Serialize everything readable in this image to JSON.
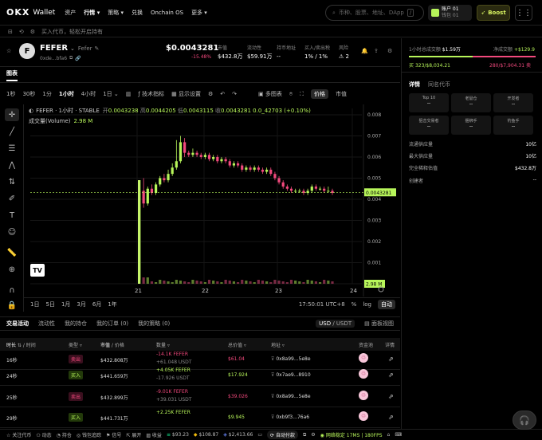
{
  "topnav": {
    "logo": "OKX",
    "product": "Wallet",
    "items": [
      "资产",
      "行情",
      "策略",
      "兑换",
      "Onchain OS",
      "更多"
    ],
    "active_index": 1,
    "search_placeholder": "币种、股票、地址、DApp",
    "search_shortcut": "/",
    "account_name": "账户 01",
    "account_sub": "钱包 01",
    "boost_label": "Boost"
  },
  "subbar": {
    "hint": "买入代币，轻松开启持有"
  },
  "token": {
    "avatar_letter": "F",
    "symbol": "FEFER",
    "name": "Fefer",
    "address": "0xde...bfa6",
    "price": "$0.0043281",
    "change": "-15.48%",
    "stats": [
      {
        "label": "市值",
        "value": "$432.8万"
      },
      {
        "label": "流动性",
        "value": "$59.91万"
      },
      {
        "label": "持币地址",
        "value": "--"
      },
      {
        "label": "买入/卖出税",
        "value": "1% / 1%"
      },
      {
        "label": "风险",
        "value": "2"
      }
    ]
  },
  "chart_tabs": {
    "tab": "图表"
  },
  "timeframes": {
    "items": [
      "1秒",
      "30秒",
      "1分",
      "1小时",
      "4小时",
      "1日"
    ],
    "active_index": 3,
    "indicators": "技术指标",
    "display": "显示设置",
    "multi": "多图表",
    "price_btn": "价格",
    "mcap_btn": "市值"
  },
  "legend": {
    "title": "FEFER · 1小时 · STABLE",
    "open_label": "开",
    "open": "0.0043238",
    "high_label": "高",
    "high": "0.0044205",
    "low_label": "低",
    "low": "0.0043115",
    "close_label": "收",
    "close": "0.0043281",
    "change": "0.0_42703 (+0.10%)",
    "volume_label": "成交量(Volume)",
    "volume": "2.98 M"
  },
  "chart_data": {
    "type": "candlestick",
    "xlabels": [
      "21",
      "22",
      "23",
      "24"
    ],
    "yticks": [
      "0.008",
      "0.007",
      "0.006",
      "0.005",
      "0.004",
      "0.003",
      "0.002",
      "0.001",
      "0.00"
    ],
    "ylim": [
      0,
      0.0083
    ],
    "last_price_label": "0.0043281",
    "last_volume_label": "2.98 M",
    "candles": [
      [
        0.0002,
        0.0044,
        0.0046,
        0.0001
      ],
      [
        0.0044,
        0.0038,
        0.005,
        0.0036
      ],
      [
        0.0038,
        0.0045,
        0.0046,
        0.0037
      ],
      [
        0.0045,
        0.0043,
        0.0047,
        0.0042
      ],
      [
        0.0043,
        0.0047,
        0.0048,
        0.0042
      ],
      [
        0.0047,
        0.005,
        0.0051,
        0.0046
      ],
      [
        0.005,
        0.0049,
        0.0052,
        0.0048
      ],
      [
        0.0049,
        0.0052,
        0.0054,
        0.0048
      ],
      [
        0.0052,
        0.0055,
        0.0057,
        0.0051
      ],
      [
        0.0055,
        0.0058,
        0.0068,
        0.0054
      ],
      [
        0.0058,
        0.0067,
        0.007,
        0.0057
      ],
      [
        0.0067,
        0.0062,
        0.0069,
        0.006
      ],
      [
        0.0062,
        0.0061,
        0.0063,
        0.006
      ],
      [
        0.0061,
        0.0062,
        0.0064,
        0.006
      ],
      [
        0.0062,
        0.0061,
        0.0063,
        0.006
      ],
      [
        0.0061,
        0.006,
        0.0062,
        0.0059
      ],
      [
        0.006,
        0.0061,
        0.0062,
        0.0059
      ],
      [
        0.0061,
        0.0059,
        0.0062,
        0.0058
      ],
      [
        0.0059,
        0.006,
        0.0061,
        0.0058
      ],
      [
        0.006,
        0.0058,
        0.0061,
        0.0057
      ],
      [
        0.0058,
        0.0059,
        0.006,
        0.0057
      ],
      [
        0.0059,
        0.0058,
        0.006,
        0.0057
      ],
      [
        0.0058,
        0.0056,
        0.0059,
        0.0055
      ],
      [
        0.0056,
        0.0057,
        0.0058,
        0.0055
      ],
      [
        0.0057,
        0.0056,
        0.0058,
        0.0055
      ],
      [
        0.0056,
        0.0054,
        0.0057,
        0.0053
      ],
      [
        0.0054,
        0.0055,
        0.0056,
        0.0053
      ],
      [
        0.0055,
        0.0054,
        0.0056,
        0.0053
      ],
      [
        0.0054,
        0.0055,
        0.0056,
        0.0053
      ],
      [
        0.0055,
        0.0054,
        0.0056,
        0.0053
      ],
      [
        0.0054,
        0.0053,
        0.0055,
        0.0052
      ],
      [
        0.0053,
        0.0054,
        0.0055,
        0.0052
      ],
      [
        0.0054,
        0.0052,
        0.0055,
        0.0051
      ],
      [
        0.0052,
        0.005,
        0.0053,
        0.0049
      ],
      [
        0.005,
        0.0048,
        0.0051,
        0.0047
      ],
      [
        0.0048,
        0.0046,
        0.0049,
        0.0045
      ],
      [
        0.0046,
        0.0045,
        0.0047,
        0.0044
      ],
      [
        0.0045,
        0.0044,
        0.0046,
        0.0043
      ],
      [
        0.0044,
        0.0044,
        0.0045,
        0.0043
      ],
      [
        0.0044,
        0.0044,
        0.0045,
        0.0043
      ],
      [
        0.0044,
        0.0043,
        0.0045,
        0.0042
      ],
      [
        0.0043,
        0.0044,
        0.0045,
        0.0042
      ],
      [
        0.0044,
        0.0046,
        0.0047,
        0.0043
      ],
      [
        0.0046,
        0.0045,
        0.0047,
        0.0044
      ],
      [
        0.0045,
        0.0045,
        0.0046,
        0.0044
      ],
      [
        0.0045,
        0.0044,
        0.0046,
        0.0043
      ],
      [
        0.0044,
        0.0044,
        0.0046,
        0.0043
      ],
      [
        0.0044,
        0.0043,
        0.0045,
        0.0042
      ]
    ]
  },
  "range": {
    "items": [
      "1日",
      "5日",
      "1月",
      "3月",
      "6月",
      "1年"
    ],
    "time": "17:50:01 UTC+8",
    "pct": "%",
    "log": "log",
    "auto": "自动"
  },
  "bottom_tabs": {
    "items": [
      "交易活动",
      "流动性",
      "我的持仓",
      "我的订单 (0)",
      "我的策略 (0)"
    ],
    "active_index": 0,
    "unit_on": "USD",
    "unit_off": "USDT",
    "view": "面板视图"
  },
  "table": {
    "headers": [
      "时长",
      "时间",
      "类型",
      "市值",
      "价格",
      "数量",
      "总价值",
      "地址",
      "资金池",
      "详情"
    ],
    "rows": [
      {
        "time": "16秒",
        "type": "卖出",
        "side": "sell",
        "mcap": "$432.808万",
        "qty1": "-14.1K FEFER",
        "qty2": "+61.048 USDT",
        "total": "$61.04",
        "addr": "0x8a99...5e8e"
      },
      {
        "time": "24秒",
        "type": "买入",
        "side": "buy",
        "mcap": "$441.659万",
        "qty1": "+4.05K FEFER",
        "qty2": "-17.926 USDT",
        "total": "$17.924",
        "addr": "0x7ae9...8910"
      },
      {
        "time": "25秒",
        "type": "卖出",
        "side": "sell",
        "mcap": "$432.899万",
        "qty1": "-9.01K FEFER",
        "qty2": "+39.031 USDT",
        "total": "$39.026",
        "addr": "0x8a99...5e8e"
      },
      {
        "time": "29秒",
        "type": "买入",
        "side": "buy",
        "mcap": "$441.731万",
        "qty1": "+2.25K FEFER",
        "qty2": "",
        "total": "$9.945",
        "addr": "0xb9f3...76a6"
      }
    ]
  },
  "right": {
    "vol_label": "1小时总成交额",
    "vol_value": "$1.59万",
    "net_label": "净成交额",
    "net_value": "+$129.9",
    "buy_label": "买",
    "buy_value": "323/$8,034.21",
    "sell_label": "卖",
    "sell_value": "280/$7,904.31",
    "buy_ratio": 0.505,
    "tabs": [
      "详情",
      "同名代币"
    ],
    "tiles": [
      {
        "label": "Top 10",
        "value": "--"
      },
      {
        "label": "老鼠仓",
        "value": "--"
      },
      {
        "label": "开发者",
        "value": "--"
      },
      {
        "label": "狙击交易者",
        "value": "--"
      },
      {
        "label": "捆绑手",
        "value": "--"
      },
      {
        "label": "钓鱼手",
        "value": "--"
      }
    ],
    "kvs": [
      {
        "k": "流通供应量",
        "v": "10亿"
      },
      {
        "k": "最大供应量",
        "v": "10亿"
      },
      {
        "k": "完全稀释估值",
        "v": "$432.8万"
      },
      {
        "k": "创建者",
        "v": "--"
      }
    ]
  },
  "footer": {
    "items": [
      "关注代币",
      "动态",
      "持仓",
      "钱包追踪",
      "信号",
      "展开",
      "收益"
    ],
    "prices": [
      "$93.23",
      "$108.87",
      "$2,413.66"
    ],
    "auto_pay": "自动付款",
    "network": "网络稳定 17MS | 180FPS"
  }
}
